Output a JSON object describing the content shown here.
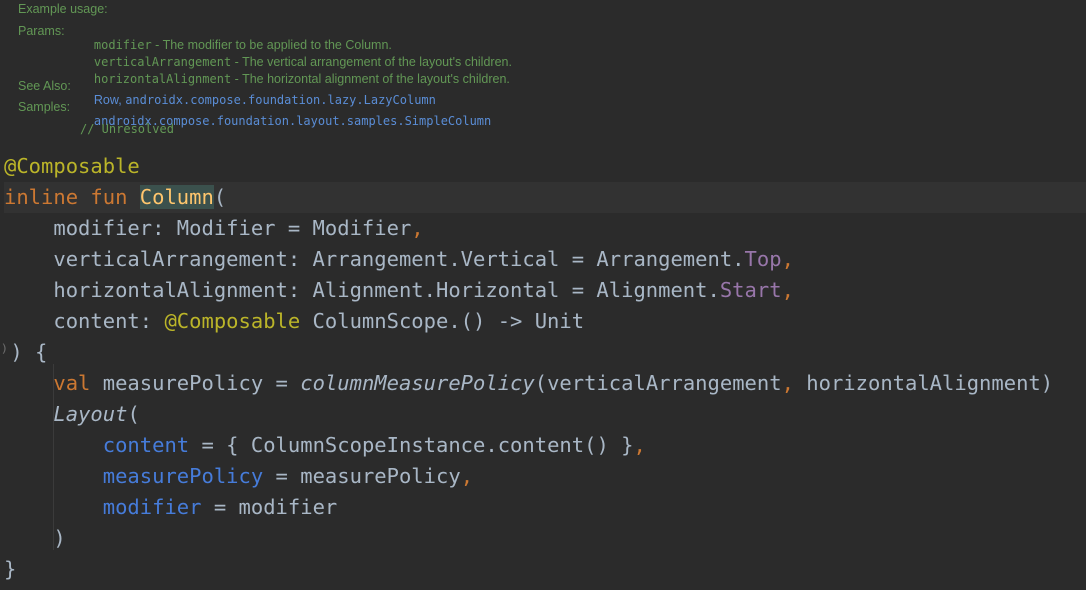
{
  "doc": {
    "example_usage": "Example usage:",
    "params_label": "Params:",
    "params": [
      {
        "name": "modifier",
        "desc": " - The modifier to be applied to the Column."
      },
      {
        "name": "verticalArrangement",
        "desc": " - The vertical arrangement of the layout's children."
      },
      {
        "name": "horizontalAlignment",
        "desc": " - The horizontal alignment of the layout's children."
      }
    ],
    "see_also_label": "See Also:",
    "see_also_row": "Row",
    "see_also_sep": ",",
    "see_also_lazy": "androidx.compose.foundation.lazy.LazyColumn",
    "samples_label": "Samples:",
    "samples_link": "androidx.compose.foundation.layout.samples.SimpleColumn",
    "samples_note": "// Unresolved"
  },
  "code": {
    "lines": [
      [
        {
          "t": "@Composable",
          "c": "ann"
        }
      ],
      [
        {
          "t": "inline fun ",
          "c": "kw"
        },
        {
          "t": "Column",
          "c": "fn-hl"
        },
        {
          "t": "(",
          "c": "text"
        }
      ],
      [
        {
          "t": "    modifier: Modifier = Modifier",
          "c": "text"
        },
        {
          "t": ",",
          "c": "kw"
        }
      ],
      [
        {
          "t": "    verticalArrangement: Arrangement.Vertical = Arrangement.",
          "c": "text"
        },
        {
          "t": "Top",
          "c": "prop"
        },
        {
          "t": ",",
          "c": "kw"
        }
      ],
      [
        {
          "t": "    horizontalAlignment: Alignment.Horizontal = Alignment.",
          "c": "text"
        },
        {
          "t": "Start",
          "c": "prop"
        },
        {
          "t": ",",
          "c": "kw"
        }
      ],
      [
        {
          "t": "    content: ",
          "c": "text"
        },
        {
          "t": "@Composable",
          "c": "ann"
        },
        {
          "t": " ColumnScope.() -> Unit",
          "c": "text"
        }
      ],
      [
        {
          "t": "⁾",
          "c": "fold"
        },
        {
          "t": ") {",
          "c": "text"
        }
      ],
      [
        {
          "t": "    ",
          "c": "text"
        },
        {
          "t": "val",
          "c": "kw"
        },
        {
          "t": " measurePolicy = ",
          "c": "text"
        },
        {
          "t": "columnMeasurePolicy",
          "c": "italic"
        },
        {
          "t": "(verticalArrangement",
          "c": "text"
        },
        {
          "t": ",",
          "c": "kw"
        },
        {
          "t": " horizontalAlignment)",
          "c": "text"
        }
      ],
      [
        {
          "t": "    ",
          "c": "text"
        },
        {
          "t": "Layout",
          "c": "italic"
        },
        {
          "t": "(",
          "c": "text"
        }
      ],
      [
        {
          "t": "        ",
          "c": "text"
        },
        {
          "t": "content",
          "c": "param"
        },
        {
          "t": " = { ColumnScopeInstance.content() }",
          "c": "text"
        },
        {
          "t": ",",
          "c": "kw"
        }
      ],
      [
        {
          "t": "        ",
          "c": "text"
        },
        {
          "t": "measurePolicy",
          "c": "param"
        },
        {
          "t": " = measurePolicy",
          "c": "text"
        },
        {
          "t": ",",
          "c": "kw"
        }
      ],
      [
        {
          "t": "        ",
          "c": "text"
        },
        {
          "t": "modifier",
          "c": "param"
        },
        {
          "t": " = modifier",
          "c": "text"
        }
      ],
      [
        {
          "t": "    )",
          "c": "text"
        }
      ],
      [
        {
          "t": "}",
          "c": "text"
        }
      ]
    ]
  },
  "colors": {
    "background": "#2b2b2b",
    "keyword": "#cc7832",
    "annotation": "#bbb529",
    "function": "#ffc66d",
    "identifier": "#a9b7c6",
    "property": "#9876aa",
    "named_param": "#467cda",
    "doc_text": "#629755",
    "doc_link": "#5a8dd6"
  }
}
